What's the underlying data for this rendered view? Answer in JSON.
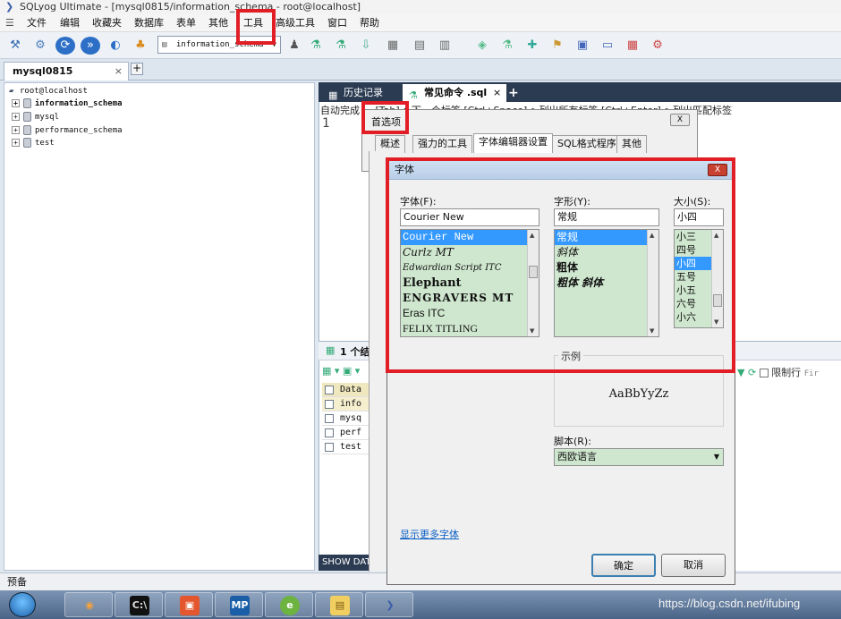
{
  "window": {
    "title": "SQLyog Ultimate - [mysql0815/information_schema - root@localhost]"
  },
  "menu": [
    "文件",
    "编辑",
    "收藏夹",
    "数据库",
    "表单",
    "其他",
    "工具",
    "高级工具",
    "窗口",
    "帮助"
  ],
  "toolbar": {
    "database_select": "information_schema"
  },
  "connection_tab": {
    "label": "mysql0815",
    "close": "×",
    "add": "+"
  },
  "tree": {
    "root": "root@localhost",
    "databases": [
      "information_schema",
      "mysql",
      "performance_schema",
      "test"
    ]
  },
  "query_tabs": [
    {
      "label": "历史记录"
    },
    {
      "label": "常见命令 .sql",
      "close": "×"
    },
    {
      "add": "+"
    }
  ],
  "editor": {
    "hint": "自动完成 ... [Tab]->下一个标签  [Ctrl+Space]->列出所有标签  [Ctrl+Enter]->列出匹配标签",
    "line_number": "1"
  },
  "result": {
    "title": "1 个结果",
    "rows": [
      "Data",
      "info",
      "mysq",
      "perf",
      "test"
    ],
    "show_databases": "SHOW DATAB",
    "limit_label": "限制行",
    "first_label": "Fir"
  },
  "status_bar": {
    "text": "预备"
  },
  "preferences_dialog": {
    "title": "首选项",
    "close": "X",
    "tabs": [
      "概述",
      "强力的工具",
      "字体编辑器设置",
      "SQL格式程序",
      "其他"
    ],
    "active_tab": "字体编辑器设置"
  },
  "font_dialog": {
    "title": "字体",
    "close": "X",
    "font_label": "字体(F):",
    "font_value": "Courier New",
    "fonts": [
      "Courier New",
      "Curlz MT",
      "Edwardian Script ITC",
      "Elephant",
      "ENGRAVERS MT",
      "Eras ITC",
      "FELIX TITLING"
    ],
    "style_label": "字形(Y):",
    "style_value": "常规",
    "styles": [
      "常规",
      "斜体",
      "粗体",
      "粗体 斜体"
    ],
    "size_label": "大小(S):",
    "size_value": "小四",
    "sizes": [
      "小三",
      "四号",
      "小四",
      "五号",
      "小五",
      "六号",
      "小六"
    ],
    "sample_label": "示例",
    "sample_text": "AaBbYyZz",
    "script_label": "脚本(R):",
    "script_value": "西欧语言",
    "more_fonts": "显示更多字体",
    "ok": "确定",
    "cancel": "取消"
  },
  "watermark": "https://blog.csdn.net/ifubing",
  "colors": {
    "highlight": "#e11d25",
    "selection": "#3399ff",
    "list_bg": "#cfe7cf"
  }
}
